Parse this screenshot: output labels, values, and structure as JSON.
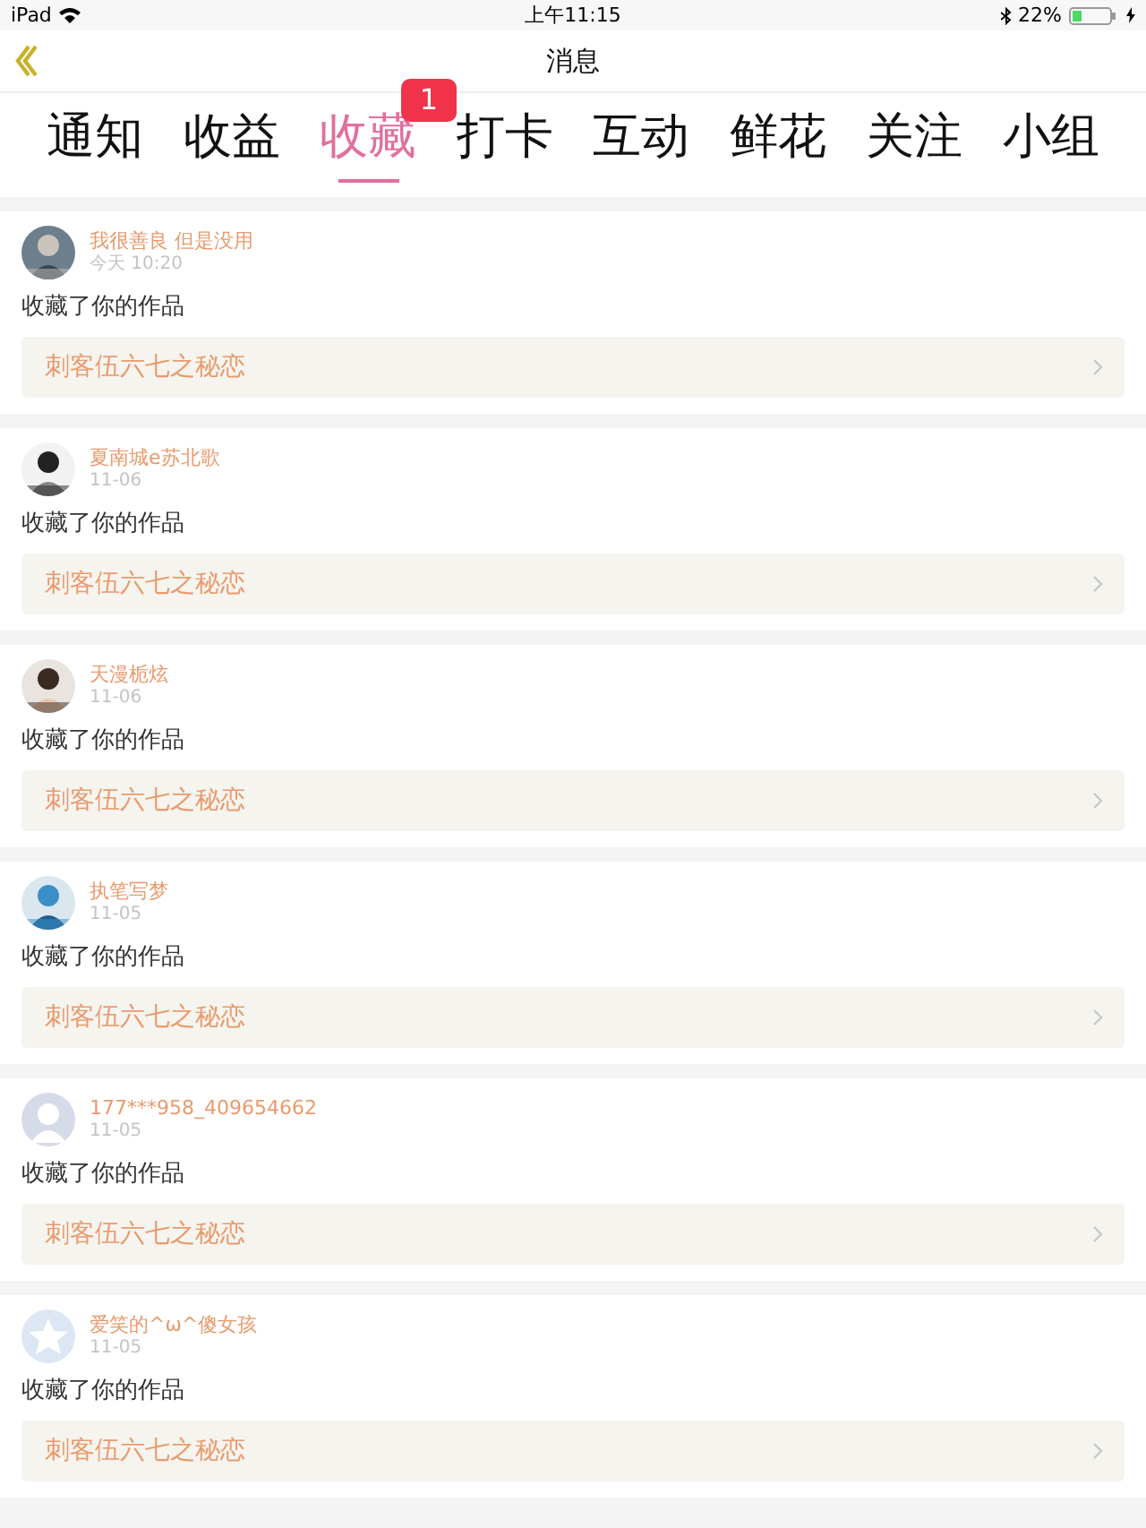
{
  "status_bar": {
    "device": "iPad",
    "time": "上午11:15",
    "battery": "22%"
  },
  "nav": {
    "title": "消息"
  },
  "tabs": [
    {
      "label": "通知",
      "selected": false
    },
    {
      "label": "收益",
      "selected": false
    },
    {
      "label": "收藏",
      "selected": true,
      "badge": "1"
    },
    {
      "label": "打卡",
      "selected": false
    },
    {
      "label": "互动",
      "selected": false
    },
    {
      "label": "鲜花",
      "selected": false
    },
    {
      "label": "关注",
      "selected": false
    },
    {
      "label": "小组",
      "selected": false
    }
  ],
  "items": [
    {
      "user": "我很善良 但是没用",
      "time": "今天 10:20",
      "action": "收藏了你的作品",
      "work": "刺客伍六七之秘恋"
    },
    {
      "user": "夏南城e苏北歌",
      "time": "11-06",
      "action": "收藏了你的作品",
      "work": "刺客伍六七之秘恋"
    },
    {
      "user": "天漫栀炫",
      "time": "11-06",
      "action": "收藏了你的作品",
      "work": "刺客伍六七之秘恋"
    },
    {
      "user": "执笔写梦",
      "time": "11-05",
      "action": "收藏了你的作品",
      "work": "刺客伍六七之秘恋"
    },
    {
      "kind": "default",
      "user": "177***958_409654662",
      "time": "11-05",
      "action": "收藏了你的作品",
      "work": "刺客伍六七之秘恋"
    },
    {
      "kind": "star",
      "user": "爱笑的^ω^傻女孩",
      "time": "11-05",
      "action": "收藏了你的作品",
      "work": "刺客伍六七之秘恋"
    }
  ]
}
